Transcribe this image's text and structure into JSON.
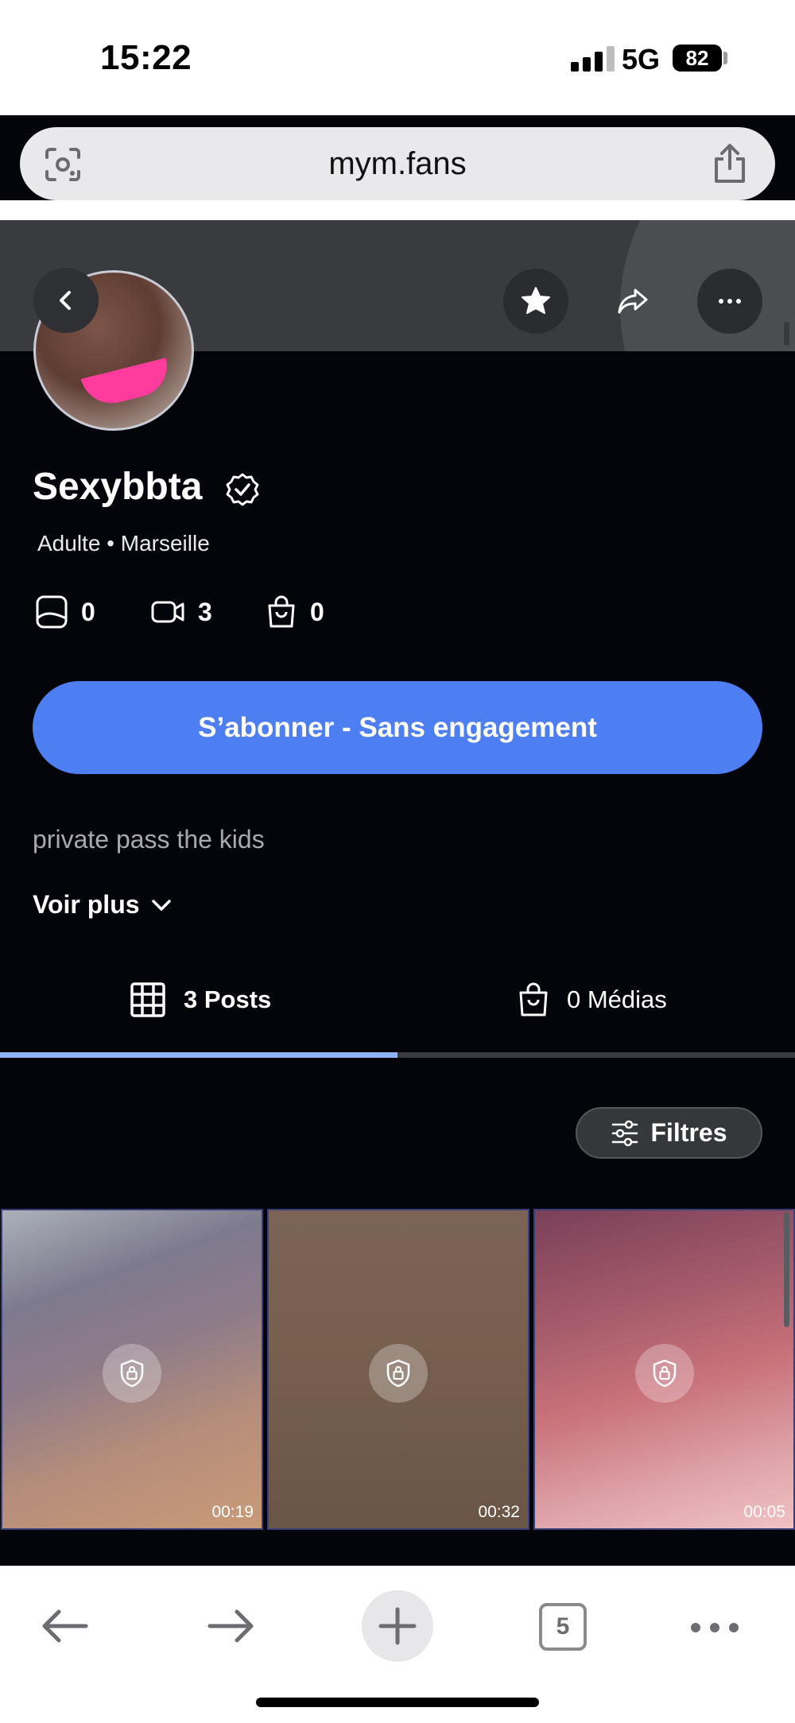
{
  "status_bar": {
    "time": "15:22",
    "network": "5G",
    "battery": "82"
  },
  "browser": {
    "url": "mym.fans",
    "open_tabs": "5"
  },
  "profile": {
    "name": "Sexybbta",
    "subtitle": "Adulte • Marseille",
    "stats": {
      "photos": "0",
      "videos": "3",
      "products": "0"
    },
    "subscribe_label": "S’abonner - Sans engagement",
    "bio": "private pass the kids",
    "see_more_label": "Voir plus"
  },
  "tabs": [
    {
      "label": "3 Posts",
      "active": true
    },
    {
      "label": "0 Médias",
      "active": false
    }
  ],
  "filters_label": "Filtres",
  "posts": [
    {
      "duration": "00:19"
    },
    {
      "duration": "00:32"
    },
    {
      "duration": "00:05"
    }
  ],
  "colors": {
    "accent": "#4d7ef2",
    "background": "#04050a",
    "tab_indicator": "#8eb3f6"
  }
}
